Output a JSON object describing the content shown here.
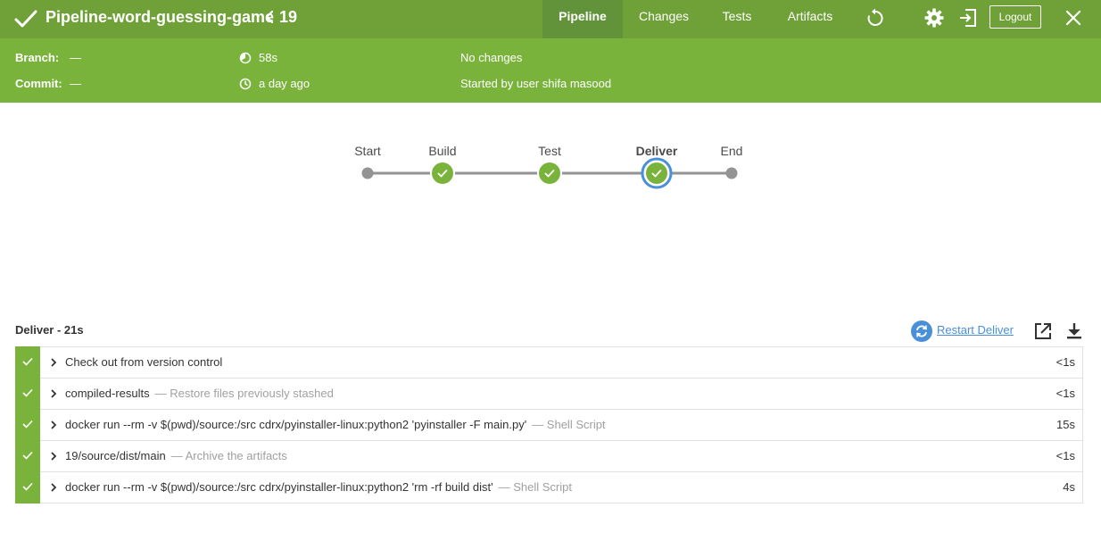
{
  "header": {
    "title": "Pipeline-word-guessing-game",
    "run_number": "19",
    "tabs": [
      {
        "label": "Pipeline",
        "active": true
      },
      {
        "label": "Changes",
        "active": false
      },
      {
        "label": "Tests",
        "active": false
      },
      {
        "label": "Artifacts",
        "active": false
      }
    ],
    "logout_label": "Logout",
    "icons": [
      "check-icon",
      "chevron-left-icon",
      "replay-icon",
      "gear-icon",
      "exit-icon",
      "close-icon"
    ]
  },
  "info": {
    "branch_label": "Branch:",
    "branch_value": "—",
    "commit_label": "Commit:",
    "commit_value": "—",
    "duration": "58s",
    "time_ago": "a day ago",
    "changes": "No changes",
    "started_by": "Started by user shifa masood"
  },
  "graph": {
    "stages": [
      {
        "label": "Start",
        "kind": "terminal",
        "selected": false
      },
      {
        "label": "Build",
        "kind": "success",
        "selected": false
      },
      {
        "label": "Test",
        "kind": "success",
        "selected": false
      },
      {
        "label": "Deliver",
        "kind": "success",
        "selected": true
      },
      {
        "label": "End",
        "kind": "terminal",
        "selected": false
      }
    ]
  },
  "steps_panel": {
    "header": "Deliver - 21s",
    "restart_label": "Restart Deliver",
    "steps": [
      {
        "name": "Check out from version control",
        "desc": "",
        "duration": "<1s"
      },
      {
        "name": "compiled-results",
        "desc": "— Restore files previously stashed",
        "duration": "<1s"
      },
      {
        "name": "docker run --rm -v $(pwd)/source:/src cdrx/pyinstaller-linux:python2 'pyinstaller -F main.py'",
        "desc": "— Shell Script",
        "duration": "15s"
      },
      {
        "name": "19/source/dist/main",
        "desc": "— Archive the artifacts",
        "duration": "<1s"
      },
      {
        "name": "docker run --rm -v $(pwd)/source:/src cdrx/pyinstaller-linux:python2 'rm -rf build dist'",
        "desc": "— Shell Script",
        "duration": "4s"
      }
    ]
  },
  "colors": {
    "topbar": "#6fa138",
    "info_strip": "#7ab33c",
    "success": "#7ab33c",
    "terminal_node": "#949393",
    "selected_ring": "#4a90d9",
    "link": "#4a90d9"
  }
}
